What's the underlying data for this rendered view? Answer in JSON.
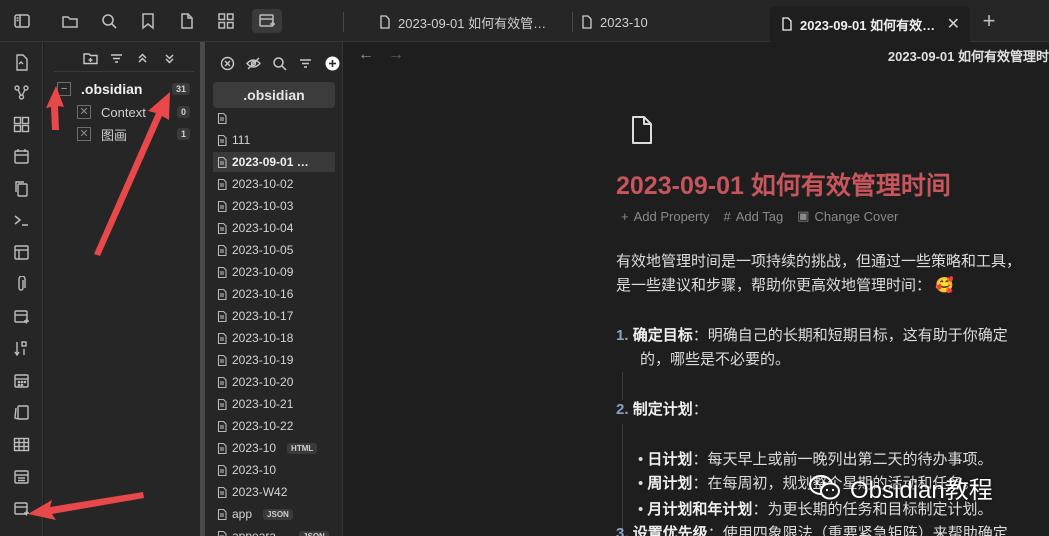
{
  "tabs": [
    {
      "label": "2023-09-01 如何有效管…"
    },
    {
      "label": "2023-10"
    },
    {
      "label": "2023-09-01 如何有效…",
      "active": true
    }
  ],
  "folder_tree": {
    "root": {
      "label": ".obsidian",
      "count": "31"
    },
    "children": [
      {
        "label": "Context",
        "count": "0"
      },
      {
        "label": "图画",
        "count": "1"
      }
    ]
  },
  "file_list": {
    "folder_name": ".obsidian",
    "files": [
      {
        "name": "",
        "ext": ""
      },
      {
        "name": "111",
        "ext": ""
      },
      {
        "name": "2023-09-01 …",
        "ext": "",
        "selected": true
      },
      {
        "name": "2023-10-02",
        "ext": ""
      },
      {
        "name": "2023-10-03",
        "ext": ""
      },
      {
        "name": "2023-10-04",
        "ext": ""
      },
      {
        "name": "2023-10-05",
        "ext": ""
      },
      {
        "name": "2023-10-09",
        "ext": ""
      },
      {
        "name": "2023-10-16",
        "ext": ""
      },
      {
        "name": "2023-10-17",
        "ext": ""
      },
      {
        "name": "2023-10-18",
        "ext": ""
      },
      {
        "name": "2023-10-19",
        "ext": ""
      },
      {
        "name": "2023-10-20",
        "ext": ""
      },
      {
        "name": "2023-10-21",
        "ext": ""
      },
      {
        "name": "2023-10-22",
        "ext": ""
      },
      {
        "name": "2023-10",
        "ext": "HTML"
      },
      {
        "name": "2023-10",
        "ext": ""
      },
      {
        "name": "2023-W42",
        "ext": ""
      },
      {
        "name": "app",
        "ext": "JSON"
      },
      {
        "name": "appeara…",
        "ext": "JSON"
      }
    ]
  },
  "editor": {
    "header_title": "2023-09-01  如何有效管理时",
    "doc_title": "2023-09-01 如何有效管理时间",
    "properties": {
      "add_property": "Add Property",
      "add_tag": "Add Tag",
      "change_cover": "Change Cover"
    },
    "intro_line1": "有效地管理时间是一项持续的挑战，但通过一些策略和工具，",
    "intro_line2": "是一些建议和步骤，帮助你更高效地管理时间：",
    "emoji": "🥰",
    "item1_num": "1.",
    "item1_bold": "确定目标",
    "item1_text": "：明确自己的长期和短期目标，这有助于你确定",
    "item1_cont": "的，哪些是不必要的。",
    "item2_num": "2.",
    "item2_bold": "制定计划",
    "item2_text": "：",
    "bullets": [
      {
        "bold": "日计划",
        "text": "：每天早上或前一晚列出第二天的待办事项。"
      },
      {
        "bold": "周计划",
        "text": "：在每周初，规划整个星期的活动和任务。"
      },
      {
        "bold": "月计划和年计划",
        "text": "：为更长期的任务和目标制定计划。"
      }
    ],
    "item3_num": "3.",
    "item3_bold": "设置优先级",
    "item3_text": "：使用四象限法（重要紧急矩阵）来帮助确定"
  },
  "watermark": "Obsidian教程",
  "colors": {
    "title": "#c7555c",
    "arrow": "#e8484a",
    "list_number": "#8ca2c7"
  }
}
